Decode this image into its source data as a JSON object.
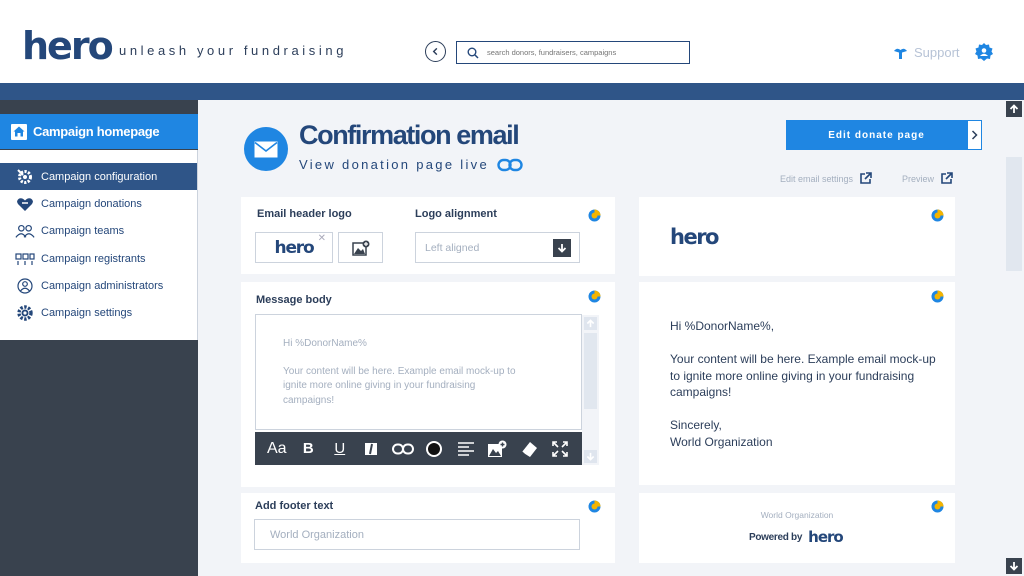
{
  "brand": {
    "logo": "hero",
    "tagline": "unleash your fundraising"
  },
  "search": {
    "placeholder": "search donors, fundraisers, campaigns"
  },
  "header": {
    "support_label": "Support"
  },
  "sidebar": {
    "home_label": "Campaign homepage",
    "items": [
      {
        "label": "Campaign configuration",
        "icon": "gear-wrench-icon",
        "active": true
      },
      {
        "label": "Campaign donations",
        "icon": "heart-hand-icon"
      },
      {
        "label": "Campaign teams",
        "icon": "users-icon"
      },
      {
        "label": "Campaign registrants",
        "icon": "registrants-icon"
      },
      {
        "label": "Campaign administrators",
        "icon": "admin-icon"
      },
      {
        "label": "Campaign settings",
        "icon": "gear-icon"
      }
    ]
  },
  "page": {
    "title": "Confirmation email",
    "view_live": "View donation page live",
    "edit_donate_label": "Edit donate page",
    "edit_email_settings": "Edit email settings",
    "preview_label": "Preview"
  },
  "editor_form": {
    "header_logo_label": "Email header logo",
    "logo_preview_text": "hero",
    "alignment_label": "Logo alignment",
    "alignment_value": "Left aligned",
    "message_body_label": "Message body",
    "message_lines": [
      "Hi %DonorName%",
      "Your content will be here. Example email mock-up to ignite more online giving in your fundraising campaigns!"
    ],
    "footer_label": "Add footer text",
    "footer_value": "World Organization"
  },
  "preview": {
    "logo": "hero",
    "greeting": "Hi %DonorName%,",
    "body": "Your content will be here.  Example email mock-up to ignite more online giving in your fundraising campaigns!",
    "signoff": "Sincerely,",
    "signature": "World Organization",
    "footer_org": "World Organization",
    "powered_by": "Powered by",
    "powered_logo": "hero"
  },
  "toolbar": {
    "font_label": "Aa",
    "bold_label": "B",
    "underline_label": "U"
  },
  "colors": {
    "brand_navy": "#24477a",
    "accent_blue": "#1f86e2",
    "sidebar_dark": "#39424e",
    "strip_blue": "#2f5588"
  }
}
